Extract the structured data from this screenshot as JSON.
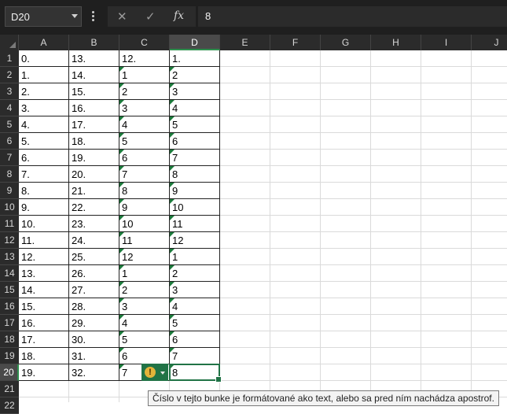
{
  "name_box": "D20",
  "formula_value": "8",
  "fx_label": "fx",
  "columns": [
    "A",
    "B",
    "C",
    "D",
    "E",
    "F",
    "G",
    "H",
    "I",
    "J"
  ],
  "rows": [
    "1",
    "2",
    "3",
    "4",
    "5",
    "6",
    "7",
    "8",
    "9",
    "10",
    "11",
    "12",
    "13",
    "14",
    "15",
    "16",
    "17",
    "18",
    "19",
    "20",
    "21",
    "22"
  ],
  "col_a": [
    "0.",
    "1.",
    "2.",
    "3.",
    "4.",
    "5.",
    "6.",
    "7.",
    "8.",
    "9.",
    "10.",
    "11.",
    "12.",
    "13.",
    "14.",
    "15.",
    "16.",
    "17.",
    "18.",
    "19."
  ],
  "col_b": [
    "13.",
    "14.",
    "15.",
    "16.",
    "17.",
    "18.",
    "19.",
    "20.",
    "21.",
    "22.",
    "23.",
    "24.",
    "25.",
    "26.",
    "27.",
    "28.",
    "29.",
    "30.",
    "31.",
    "32."
  ],
  "col_c": [
    "12.",
    "1",
    "2",
    "3",
    "4",
    "5",
    "6",
    "7",
    "8",
    "9",
    "10",
    "11",
    "12",
    "1",
    "2",
    "3",
    "4",
    "5",
    "6",
    "7"
  ],
  "col_d": [
    "1.",
    "2",
    "3",
    "4",
    "5",
    "6",
    "7",
    "8",
    "9",
    "10",
    "11",
    "12",
    "1",
    "2",
    "3",
    "4",
    "5",
    "6",
    "7",
    "8"
  ],
  "selected_column": "D",
  "selected_row": "20",
  "warning_glyph": "!",
  "tooltip": "Číslo v tejto bunke je formátované ako text, alebo sa pred ním nachádza apostrof.",
  "colors": {
    "accent": "#217346",
    "text_indicator": "#1b7a3b",
    "header_bg": "#2b2b2b"
  }
}
